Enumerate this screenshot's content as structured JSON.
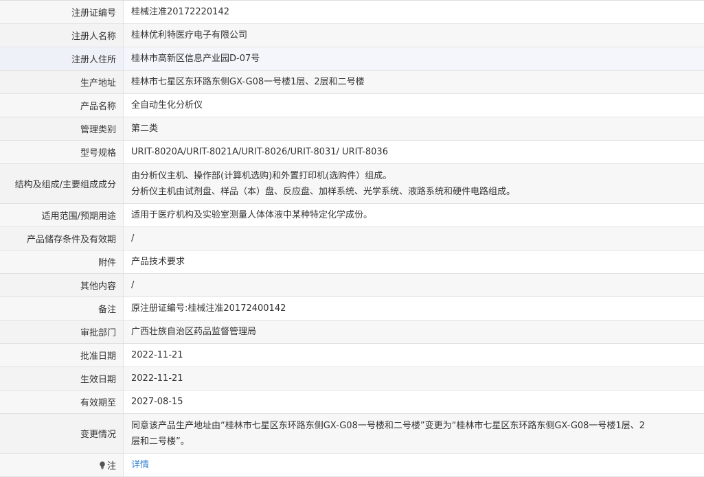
{
  "rows": [
    {
      "label": "注册证编号",
      "value": "桂械注准20172220142"
    },
    {
      "label": "注册人名称",
      "value": "桂林优利特医疗电子有限公司"
    },
    {
      "label": "注册人住所",
      "value": "桂林市高新区信息产业园D-07号"
    },
    {
      "label": "生产地址",
      "value": "桂林市七星区东环路东侧GX-G08一号楼1层、2层和二号楼"
    },
    {
      "label": "产品名称",
      "value": "全自动生化分析仪"
    },
    {
      "label": "管理类别",
      "value": "第二类"
    },
    {
      "label": "型号规格",
      "value": "URIT-8020A/URIT-8021A/URIT-8026/URIT-8031/ URIT-8036"
    },
    {
      "label": "结构及组成/主要组成成分",
      "lines": [
        "由分析仪主机、操作部(计算机选购)和外置打印机(选购件）组成。",
        "分析仪主机由试剂盘、样品（本）盘、反应盘、加样系统、光学系统、液路系统和硬件电路组成。"
      ]
    },
    {
      "label": "适用范围/预期用途",
      "value": "适用于医疗机构及实验室测量人体体液中某种特定化学成份。"
    },
    {
      "label": "产品储存条件及有效期",
      "value": "/"
    },
    {
      "label": "附件",
      "value": "产品技术要求"
    },
    {
      "label": "其他内容",
      "value": "/"
    },
    {
      "label": "备注",
      "value": "原注册证编号:桂械注准20172400142"
    },
    {
      "label": "审批部门",
      "value": "广西壮族自治区药品监督管理局"
    },
    {
      "label": "批准日期",
      "value": "2022-11-21"
    },
    {
      "label": "生效日期",
      "value": "2022-11-21"
    },
    {
      "label": "有效期至",
      "value": "2027-08-15"
    },
    {
      "label": "变更情况",
      "lines": [
        "同意该产品生产地址由“桂林市七星区东环路东侧GX-G08一号楼和二号楼”变更为“桂林市七星区东环路东侧GX-G08一号楼1层、2",
        "层和二号楼”。"
      ]
    },
    {
      "label": "注",
      "value": "详情"
    }
  ],
  "note_icon": "lightbulb-icon",
  "colors": {
    "link": "#2f7fd0",
    "border": "#e2e2e2",
    "label_bg": "#f7f7f7"
  }
}
